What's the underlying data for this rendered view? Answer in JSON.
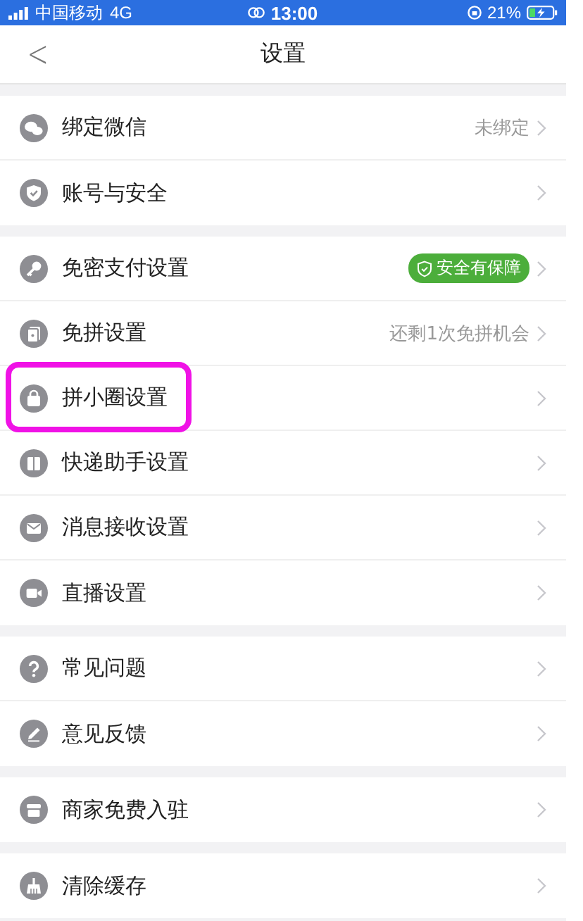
{
  "status_bar": {
    "carrier": "中国移动",
    "network": "4G",
    "time": "13:00",
    "battery": "21%"
  },
  "nav": {
    "back": "<",
    "title": "设置"
  },
  "groups": [
    {
      "items": [
        {
          "label": "绑定微信",
          "value": "未绑定",
          "kind": "text",
          "highlighted": false
        },
        {
          "label": "账号与安全",
          "kind": "plain",
          "highlighted": false
        }
      ]
    },
    {
      "items": [
        {
          "label": "免密支付设置",
          "value": "安全有保障",
          "kind": "badge",
          "highlighted": false
        },
        {
          "label": "免拼设置",
          "value": "还剩1次免拼机会",
          "kind": "text",
          "highlighted": false
        },
        {
          "label": "拼小圈设置",
          "kind": "plain",
          "highlighted": true
        },
        {
          "label": "快递助手设置",
          "kind": "plain",
          "highlighted": false
        },
        {
          "label": "消息接收设置",
          "kind": "plain",
          "highlighted": false
        },
        {
          "label": "直播设置",
          "kind": "plain",
          "highlighted": false
        }
      ]
    },
    {
      "items": [
        {
          "label": "常见问题",
          "kind": "plain",
          "highlighted": false
        },
        {
          "label": "意见反馈",
          "kind": "plain",
          "highlighted": false
        }
      ]
    },
    {
      "items": [
        {
          "label": "商家免费入驻",
          "kind": "plain",
          "highlighted": false
        }
      ]
    },
    {
      "items": [
        {
          "label": "清除缓存",
          "kind": "plain",
          "highlighted": false
        }
      ]
    }
  ]
}
